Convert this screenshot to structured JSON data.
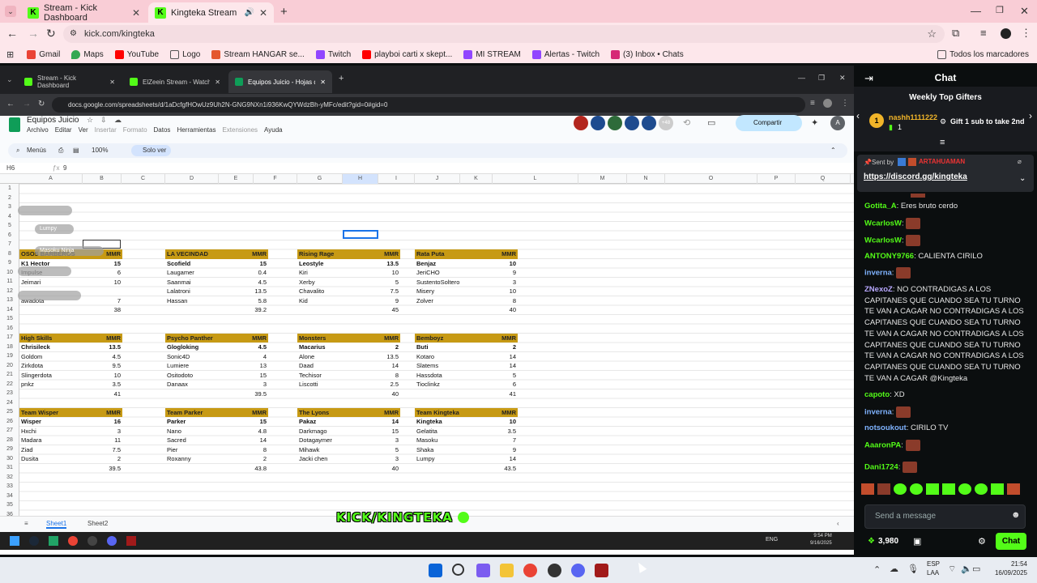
{
  "browser": {
    "tabs": [
      {
        "title": "Stream - Kick Dashboard"
      },
      {
        "title": "Kingteka Stream - Watch Li"
      }
    ],
    "url": "kick.com/kingteka",
    "bookmarks": [
      "Gmail",
      "Maps",
      "YouTube",
      "Logo",
      "Stream HANGAR se...",
      "Twitch",
      "playboi carti x skept...",
      "MI STREAM",
      "Alertas - Twitch",
      "(3) Inbox • Chats"
    ],
    "all_bookmarks": "Todos los marcadores"
  },
  "inner_browser": {
    "tabs": [
      {
        "title": "Stream - Kick Dashboard"
      },
      {
        "title": "ElZeein Stream - Watch Live o"
      },
      {
        "title": "Equipos Juicio - Hojas de cálcu"
      }
    ],
    "url": "docs.google.com/spreadsheets/d/1aDcfgfHOwUz9Uh2N-GNG9NXn1i936KwQYWdzBh-yMFc/edit?gid=0#gid=0"
  },
  "sheet": {
    "title": "Equipos Juicio",
    "menu": [
      "Archivo",
      "Editar",
      "Ver",
      "Insertar",
      "Formato",
      "Datos",
      "Herramientas",
      "Extensiones",
      "Ayuda"
    ],
    "share": "Compartir",
    "presence_count": "+48",
    "avatar": "A",
    "menus_label": "Menús",
    "zoom": "100%",
    "view_only": "Solo ver",
    "cell_ref": "H6",
    "formula_value": "9",
    "columns": [
      "A",
      "B",
      "C",
      "D",
      "E",
      "F",
      "G",
      "H",
      "I",
      "J",
      "K",
      "L",
      "M",
      "N",
      "O",
      "P",
      "Q"
    ],
    "sheet_tabs": [
      "Sheet1",
      "Sheet2"
    ],
    "tables": [
      {
        "name": "OSOS BARBEROS",
        "mmr": "MMR",
        "rows": [
          [
            "K1 Hector",
            "15"
          ],
          [
            "Impulse",
            "6"
          ],
          [
            "Jeimari",
            "10"
          ],
          [
            "",
            ""
          ],
          [
            "awadota",
            "7"
          ]
        ],
        "total": "38"
      },
      {
        "name": "LA VECINDAD",
        "mmr": "MMR",
        "rows": [
          [
            "Scofield",
            "15"
          ],
          [
            "Laugamer",
            "0.4"
          ],
          [
            "Saanmai",
            "4.5"
          ],
          [
            "Lalatroni",
            "13.5"
          ],
          [
            "Hassan",
            "5.8"
          ]
        ],
        "total": "39.2"
      },
      {
        "name": "Rising Rage",
        "mmr": "MMR",
        "rows": [
          [
            "Leostyle",
            "13.5"
          ],
          [
            "Kiri",
            "10"
          ],
          [
            "Xerby",
            "5"
          ],
          [
            "Chavalito",
            "7.5"
          ],
          [
            "Kid",
            "9"
          ]
        ],
        "total": "45"
      },
      {
        "name": "Rata Puta",
        "mmr": "MMR",
        "rows": [
          [
            "Benjaz",
            "10"
          ],
          [
            "JeriCHO",
            "9"
          ],
          [
            "SustentoSoltero",
            "3"
          ],
          [
            "Misery",
            "10"
          ],
          [
            "Zolver",
            "8"
          ]
        ],
        "total": "40"
      },
      {
        "name": "High Skills",
        "mmr": "MMR",
        "rows": [
          [
            "Chrisileck",
            "13.5"
          ],
          [
            "Goldom",
            "4.5"
          ],
          [
            "Zirkdota",
            "9.5"
          ],
          [
            "Slingerdota",
            "10"
          ],
          [
            "pnkz",
            "3.5"
          ]
        ],
        "total": "41"
      },
      {
        "name": "Psycho Panther",
        "mmr": "MMR",
        "rows": [
          [
            "Glogloking",
            "4.5"
          ],
          [
            "Sonic4D",
            "4"
          ],
          [
            "Lumiere",
            "13"
          ],
          [
            "Ositodoto",
            "15"
          ],
          [
            "Danaax",
            "3"
          ]
        ],
        "total": "39.5"
      },
      {
        "name": "Monsters",
        "mmr": "MMR",
        "rows": [
          [
            "Macarius",
            "2"
          ],
          [
            "Alone",
            "13.5"
          ],
          [
            "Daad",
            "14"
          ],
          [
            "Techisor",
            "8"
          ],
          [
            "Liscotti",
            "2.5"
          ]
        ],
        "total": "40"
      },
      {
        "name": "Bemboyz",
        "mmr": "MMR",
        "rows": [
          [
            "Buti",
            "2"
          ],
          [
            "Kotaro",
            "14"
          ],
          [
            "Slatems",
            "14"
          ],
          [
            "Hassdota",
            "5"
          ],
          [
            "Tioclinkz",
            "6"
          ]
        ],
        "total": "41"
      },
      {
        "name": "Team Wisper",
        "mmr": "MMR",
        "rows": [
          [
            "Wisper",
            "16"
          ],
          [
            "Hxchi",
            "3"
          ],
          [
            "Madara",
            "11"
          ],
          [
            "Ziad",
            "7.5"
          ],
          [
            "Dusita",
            "2"
          ]
        ],
        "total": "39.5"
      },
      {
        "name": "Team Parker",
        "mmr": "MMR",
        "rows": [
          [
            "Parker",
            "15"
          ],
          [
            "Nano",
            "4.8"
          ],
          [
            "Sacred",
            "14"
          ],
          [
            "Pier",
            "8"
          ],
          [
            "Roxanny",
            "2"
          ]
        ],
        "total": "43.8"
      },
      {
        "name": "The Lyons",
        "mmr": "MMR",
        "rows": [
          [
            "Pakaz",
            "14"
          ],
          [
            "Darkmago",
            "15"
          ],
          [
            "Dotagaymer",
            "3"
          ],
          [
            "Mihawk",
            "5"
          ],
          [
            "Jacki chen",
            "3"
          ]
        ],
        "total": "40"
      },
      {
        "name": "Team Kingteka",
        "mmr": "MMR",
        "rows": [
          [
            "Kingteka",
            "10"
          ],
          [
            "Gelatita",
            "3.5"
          ],
          [
            "Masoku",
            "7"
          ],
          [
            "Shaka",
            "9"
          ],
          [
            "Lumpy",
            "14"
          ]
        ],
        "total": "43.5"
      }
    ],
    "cursors": [
      "Lumpy",
      "Masoku",
      "Ninja"
    ]
  },
  "overlay_text": "KICK/KINGTEKA",
  "inner_clock": {
    "time": "9:54 PM",
    "date": "9/16/2025",
    "lang": "ENG"
  },
  "chat": {
    "title": "Chat",
    "gifters_title": "Weekly Top Gifters",
    "top_gifter": "nashh1111222",
    "top_gifter_count": "1",
    "gift_cta": "Gift 1 sub to take 2nd",
    "pinned_by_label": "Sent by",
    "pinned_user": "ARTAHUAMAN",
    "pinned_link": "https://discord.gg/kingteka",
    "messages": [
      {
        "user": "Gotita_A",
        "color": "#53fc18",
        "text": "Eres bruto cerdo"
      },
      {
        "user": "WcarlosW",
        "color": "#53fc18",
        "text": ""
      },
      {
        "user": "WcarlosW",
        "color": "#53fc18",
        "text": ""
      },
      {
        "user": "ANTONY9766",
        "color": "#53fc18",
        "text": "CALIENTA CIRILO"
      },
      {
        "user": "inverna",
        "color": "#7fb3ff",
        "text": ""
      },
      {
        "user": "ZNexoZ",
        "color": "#b8a8ff",
        "text": "NO CONTRADIGAS A LOS CAPITANES QUE CUANDO SEA TU TURNO TE VAN A CAGAR NO CONTRADIGAS A LOS CAPITANES QUE CUANDO SEA TU TURNO TE VAN A CAGAR NO CONTRADIGAS A LOS CAPITANES QUE CUANDO SEA TU TURNO TE VAN A CAGAR NO CONTRADIGAS A LOS CAPITANES QUE CUANDO SEA TU TURNO TE VAN A CAGAR @Kingteka"
      },
      {
        "user": "capoto",
        "color": "#53fc18",
        "text": "XD"
      },
      {
        "user": "inverna",
        "color": "#7fb3ff",
        "text": ""
      },
      {
        "user": "notsoukout",
        "color": "#7fb3ff",
        "text": "CIRILO TV"
      },
      {
        "user": "AaaronPA",
        "color": "#53fc18",
        "text": ""
      },
      {
        "user": "Dani1724",
        "color": "#53fc18",
        "text": ""
      }
    ],
    "input_placeholder": "Send a message",
    "points": "3,980",
    "chat_button": "Chat"
  },
  "taskbar": {
    "lang": "ESP",
    "lang2": "LAA",
    "time": "21:54",
    "date": "16/09/2025"
  },
  "colors": {
    "kick_green": "#53fc18",
    "header_gold": "#c79a14",
    "tab_pink": "#f9cdd6"
  }
}
